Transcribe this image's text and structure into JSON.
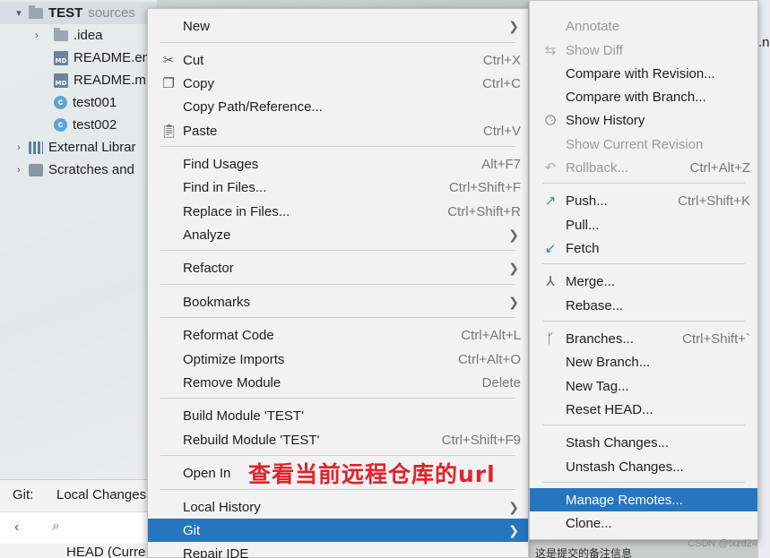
{
  "tree": {
    "root_label": "TEST",
    "root_suffix": "sources",
    "items": [
      {
        "label": ".idea",
        "icon": "folder-icon"
      },
      {
        "label": "README.en",
        "icon": "markdown-file-icon"
      },
      {
        "label": "README.m",
        "icon": "markdown-file-icon"
      },
      {
        "label": "test001",
        "icon": "class-file-icon"
      },
      {
        "label": "test002",
        "icon": "class-file-icon"
      },
      {
        "label": "External Librar",
        "icon": "library-icon"
      },
      {
        "label": "Scratches and",
        "icon": "scratch-icon"
      }
    ]
  },
  "bottom": {
    "git_label": "Git:",
    "local_changes": "Local Changes",
    "head_label": "HEAD (Curre"
  },
  "right_fragment": ".n",
  "main_menu": {
    "new": "New",
    "cut": "Cut",
    "cut_sc": "Ctrl+X",
    "copy": "Copy",
    "copy_sc": "Ctrl+C",
    "copy_path": "Copy Path/Reference...",
    "paste": "Paste",
    "paste_sc": "Ctrl+V",
    "find_usages": "Find Usages",
    "find_usages_sc": "Alt+F7",
    "find_in_files": "Find in Files...",
    "find_in_files_sc": "Ctrl+Shift+F",
    "replace_in_files": "Replace in Files...",
    "replace_in_files_sc": "Ctrl+Shift+R",
    "analyze": "Analyze",
    "refactor": "Refactor",
    "bookmarks": "Bookmarks",
    "reformat_code": "Reformat Code",
    "reformat_code_sc": "Ctrl+Alt+L",
    "optimize_imports": "Optimize Imports",
    "optimize_imports_sc": "Ctrl+Alt+O",
    "remove_module": "Remove Module",
    "remove_module_sc": "Delete",
    "build_module": "Build Module 'TEST'",
    "rebuild_module": "Rebuild Module 'TEST'",
    "rebuild_module_sc": "Ctrl+Shift+F9",
    "open_in": "Open In",
    "local_history": "Local History",
    "git": "Git",
    "repair_ide": "Repair IDE"
  },
  "git_menu": {
    "annotate": "Annotate",
    "show_diff": "Show Diff",
    "compare_revision": "Compare with Revision...",
    "compare_branch": "Compare with Branch...",
    "show_history": "Show History",
    "show_current_revision": "Show Current Revision",
    "rollback": "Rollback...",
    "rollback_sc": "Ctrl+Alt+Z",
    "push": "Push...",
    "push_sc": "Ctrl+Shift+K",
    "pull": "Pull...",
    "fetch": "Fetch",
    "merge": "Merge...",
    "rebase": "Rebase...",
    "branches": "Branches...",
    "branches_sc": "Ctrl+Shift+`",
    "new_branch": "New Branch...",
    "new_tag": "New Tag...",
    "reset_head": "Reset HEAD...",
    "stash_changes": "Stash Changes...",
    "unstash_changes": "Unstash Changes...",
    "manage_remotes": "Manage Remotes...",
    "clone": "Clone..."
  },
  "annotation": "查看当前远程仓库的url",
  "commit_msg": "这是提交的备注信息",
  "watermark": "CSDN @txzd24",
  "colors": {
    "selection": "#2675bf",
    "annotation": "#e0232b",
    "menu_bg": "#f2f2f2"
  }
}
